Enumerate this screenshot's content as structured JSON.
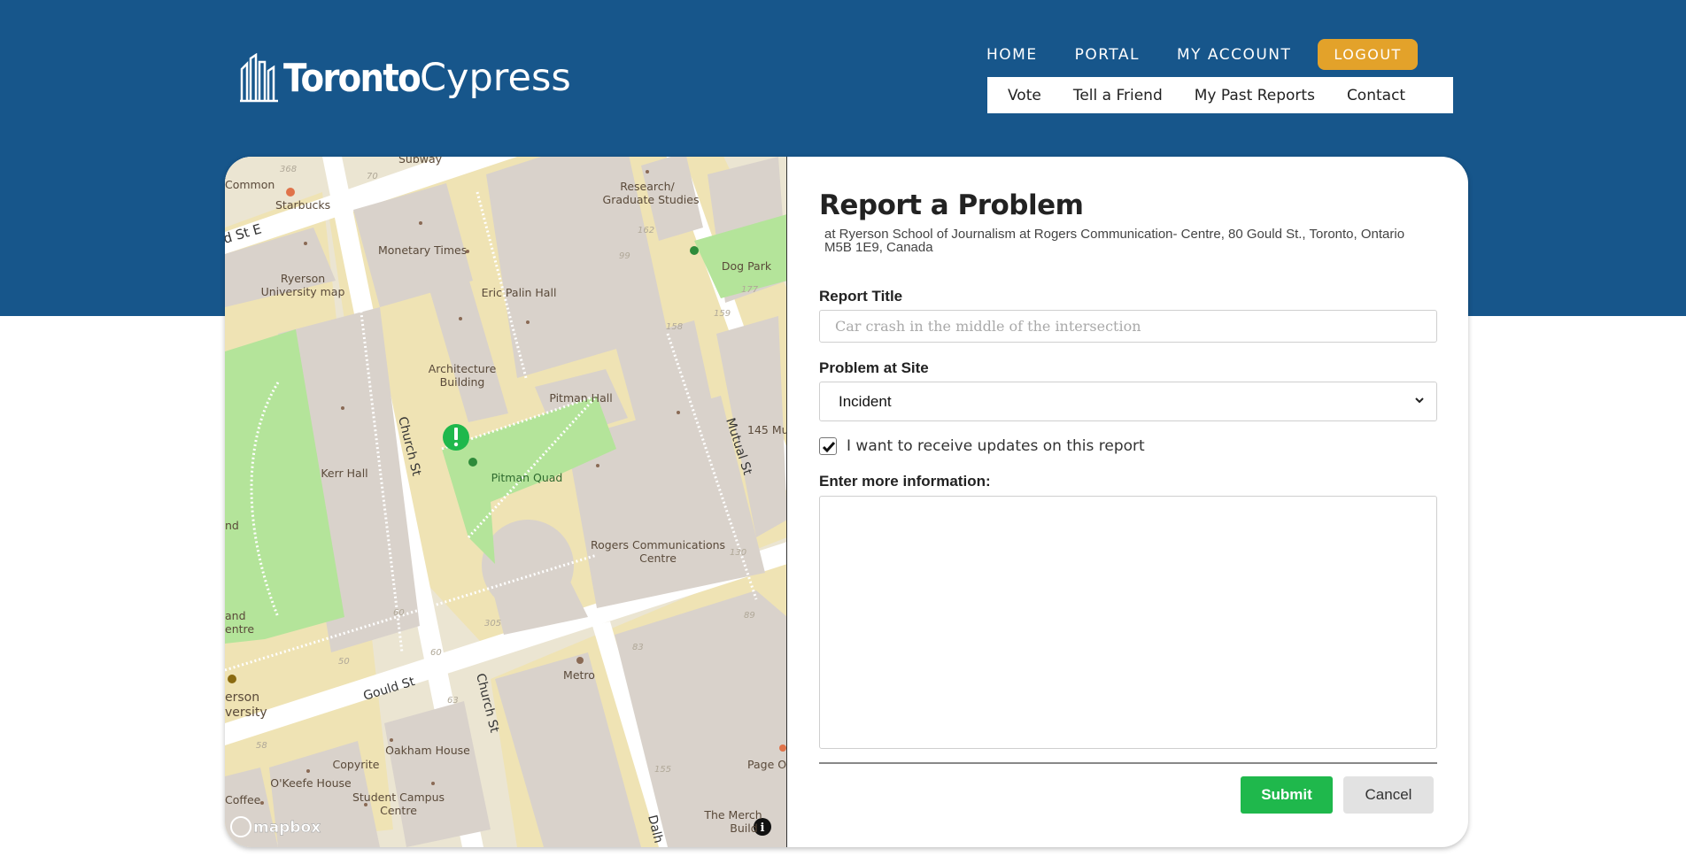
{
  "brand": {
    "name": "Toronto",
    "product": "Cypress"
  },
  "nav": {
    "primary": [
      "HOME",
      "PORTAL",
      "MY ACCOUNT"
    ],
    "logout": "LOGOUT",
    "secondary": [
      "Vote",
      "Tell a Friend",
      "My Past Reports",
      "Contact"
    ]
  },
  "map": {
    "attribution": "mapbox",
    "info_icon": "info-icon",
    "marker_icon": "exclamation-marker-icon",
    "labels": {
      "subway": "Subway",
      "common": "Common",
      "starbucks": "Starbucks",
      "st_e": "d St E",
      "monetary": "Monetary Times",
      "ryerson_map_1": "Ryerson",
      "ryerson_map_2": "University map",
      "eric": "Eric Palin Hall",
      "research_1": "Research/",
      "research_2": "Graduate Studies",
      "dog": "Dog Park",
      "arch_1": "Architecture",
      "arch_2": "Building",
      "pitman_hall": "Pitman Hall",
      "church1": "Church St",
      "mutual": "Mutual St",
      "mutual145": "145 Mu",
      "kerr": "Kerr Hall",
      "quad": "Pitman Quad",
      "nd": "nd",
      "rogers_1": "Rogers Communications",
      "rogers_2": "Centre",
      "and": "and",
      "entre": "entre",
      "ryerson_u_1": "erson",
      "ryerson_u_2": "versity",
      "gould": "Gould St",
      "church2": "Church St",
      "metro": "Metro",
      "oakham": "Oakham House",
      "copyrite": "Copyrite",
      "okeefe": "O'Keefe House",
      "scc_1": "Student Campus",
      "scc_2": "Centre",
      "coffee": "Coffee",
      "page": "Page O",
      "merch_1": "The Merch",
      "merch_2": "Build",
      "dalh": "Dalh",
      "n368": "368",
      "n70": "70",
      "n162": "162",
      "n99": "99",
      "n177": "177",
      "n159": "159",
      "n158": "158",
      "n130": "130",
      "n89": "89",
      "n83": "83",
      "n60a": "60",
      "n60b": "60",
      "n50": "50",
      "n305": "305",
      "n63": "63",
      "n58": "58",
      "n155": "155"
    }
  },
  "form": {
    "title": "Report a Problem",
    "address": "at Ryerson School of Journalism at Rogers Communication- Centre, 80 Gould St., Toronto, Ontario M5B 1E9, Canada",
    "report_title_label": "Report Title",
    "report_title_placeholder": "Car crash in the middle of the intersection",
    "problem_label": "Problem at Site",
    "problem_value": "Incident",
    "updates_checked": true,
    "updates_label": "I want to receive updates on this report",
    "info_label": "Enter more information:",
    "info_value": "",
    "submit": "Submit",
    "cancel": "Cancel"
  },
  "colors": {
    "header": "#17568b",
    "logout": "#e3a22a",
    "submit": "#1fb84c",
    "marker": "#1fb84c"
  }
}
